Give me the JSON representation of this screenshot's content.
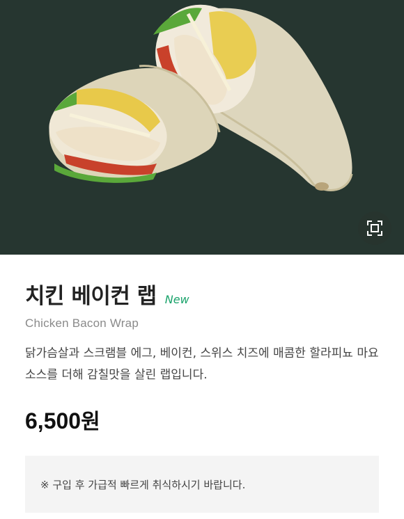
{
  "product": {
    "title": "치킨 베이컨 랩",
    "badge": "New",
    "subtitle": "Chicken Bacon Wrap",
    "description": "닭가슴살과 스크램블 에그, 베이컨, 스위스 치즈에 매콤한 할라피뇨 마요 소스를 더해 감칠맛을 살린 랩입니다.",
    "price": "6,500",
    "currency": "원",
    "notice": "※ 구입 후 가급적 빠르게 취식하시기 바랍니다."
  },
  "hero": {
    "background_color": "#263630",
    "zoom_icon": "expand-icon"
  },
  "colors": {
    "badge": "#1aa36b",
    "subtitle": "#8a8a8a",
    "notice_bg": "#f4f4f4"
  }
}
